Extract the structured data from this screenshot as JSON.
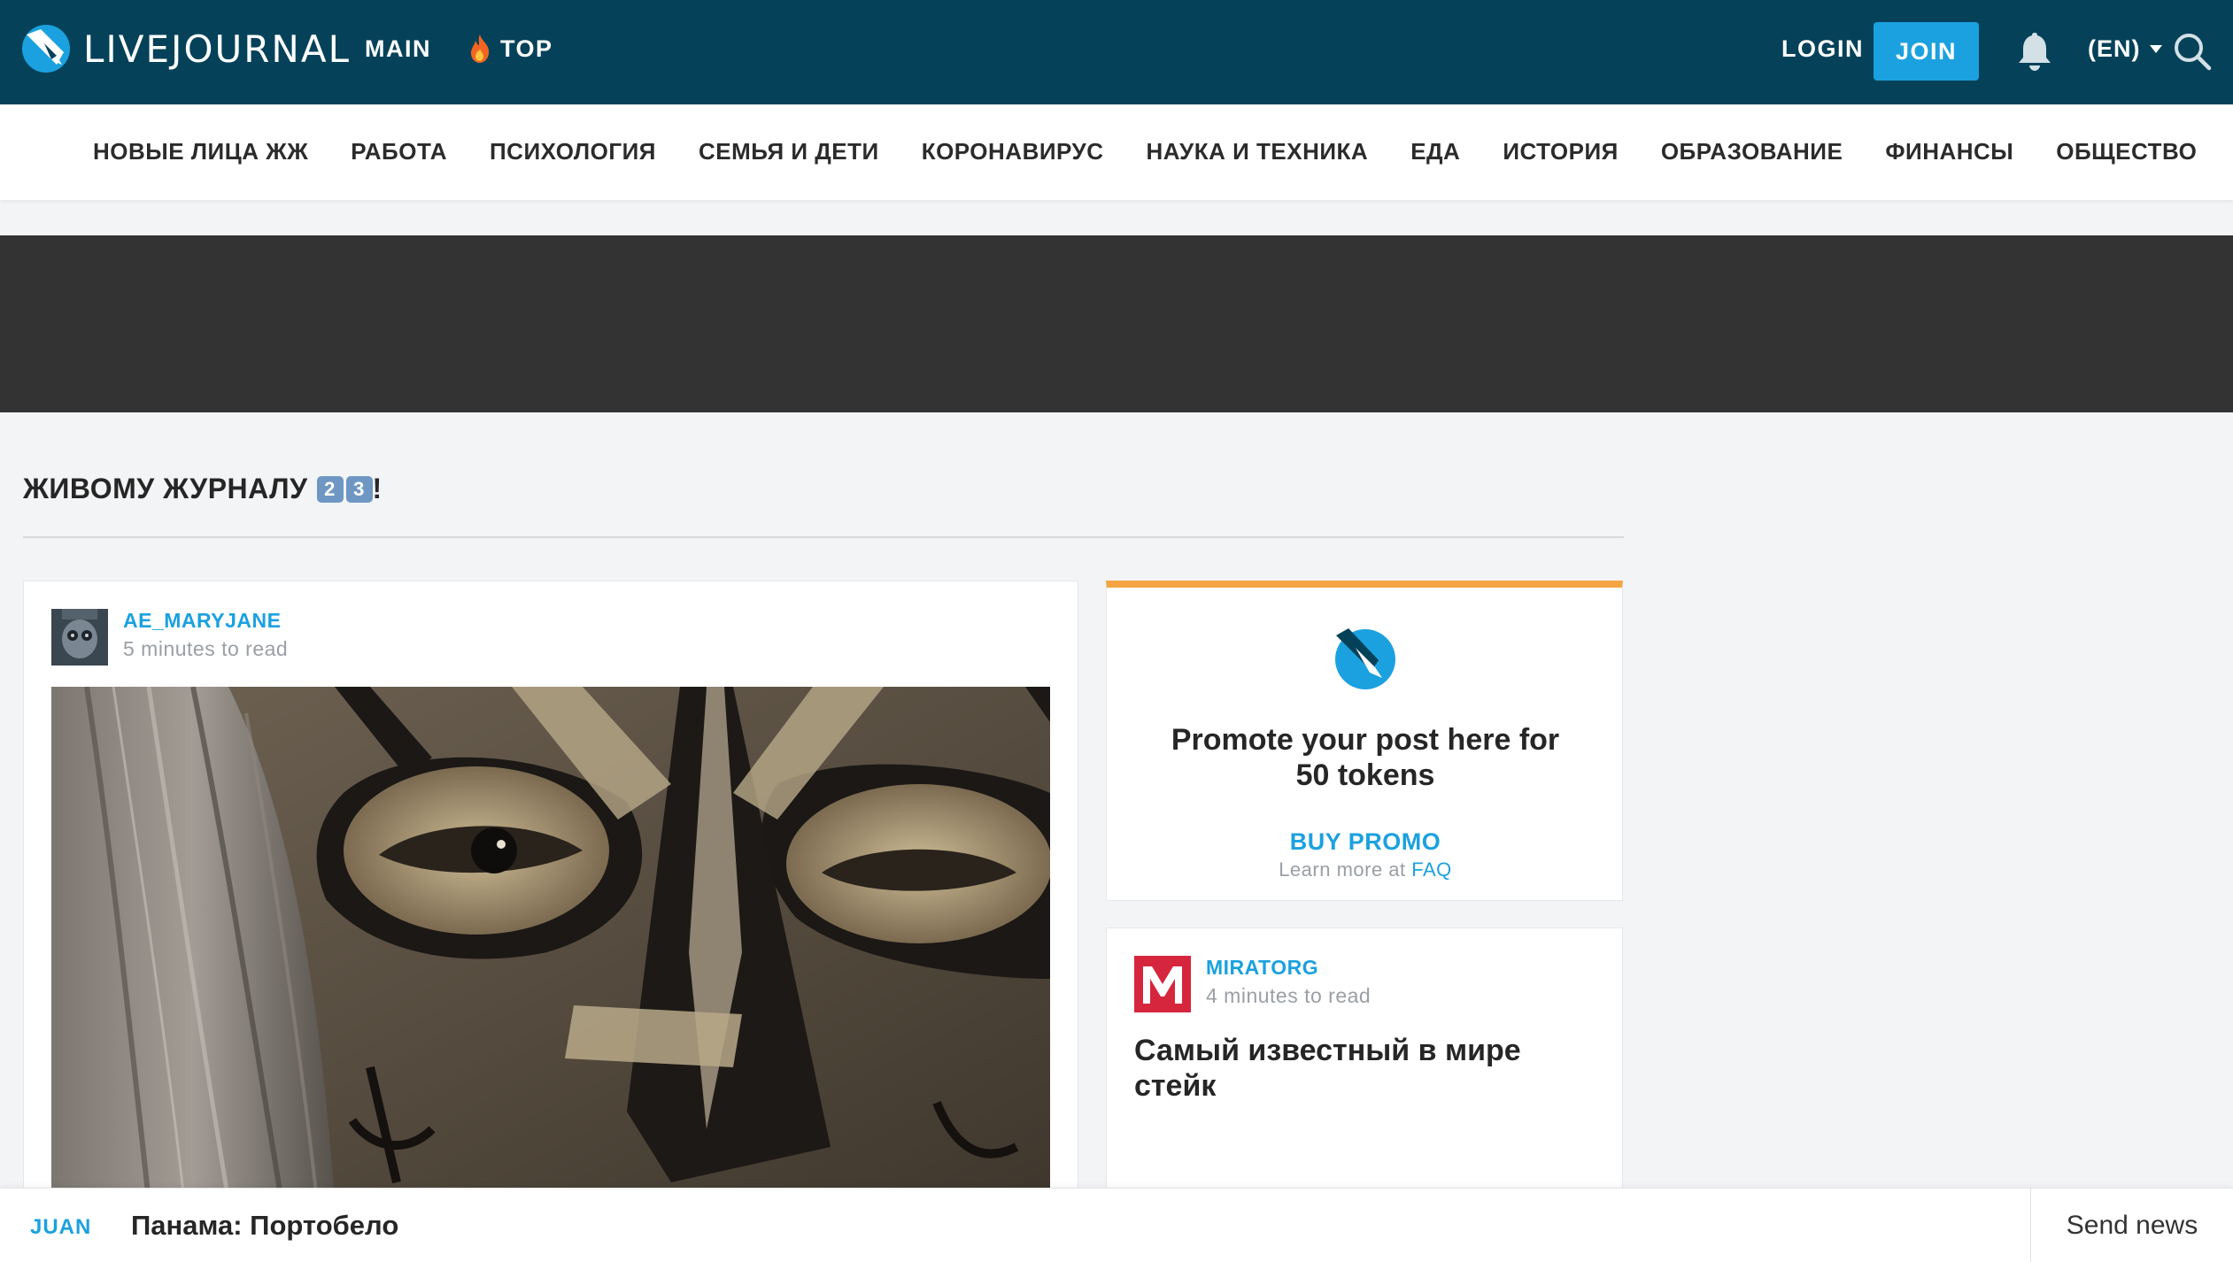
{
  "header": {
    "logo_text": "LIVEJOURNAL",
    "nav": [
      {
        "label": "MAIN"
      },
      {
        "label": "TOP",
        "icon": "flame-icon"
      }
    ],
    "login_label": "LOGIN",
    "join_label": "JOIN",
    "language_label": "(EN)",
    "colors": {
      "bar": "#054259",
      "accent": "#1ba1df"
    }
  },
  "categories": [
    "НОВЫЕ ЛИЦА ЖЖ",
    "РАБОТА",
    "ПСИХОЛОГИЯ",
    "СЕМЬЯ И ДЕТИ",
    "КОРОНАВИРУС",
    "НАУКА И ТЕХНИКА",
    "ЕДА",
    "ИСТОРИЯ",
    "ОБРАЗОВАНИЕ",
    "ФИНАНСЫ",
    "ОБЩЕСТВО"
  ],
  "section": {
    "title": "ЖИВОМУ ЖУРНАЛУ",
    "keycaps": [
      "2",
      "3"
    ],
    "suffix": "!"
  },
  "post": {
    "author": "AE_MARYJANE",
    "read_time": "5 minutes to read"
  },
  "promo": {
    "text": "Promote your post here for 50 tokens",
    "button_label": "BUY PROMO",
    "learn_more_prefix": "Learn more at",
    "faq_label": "FAQ",
    "accent_color": "#f5a442"
  },
  "feature_post": {
    "author": "MIRATORG",
    "read_time": "4 minutes to read",
    "title": "Самый известный в мире стейк",
    "logo_letter": "M",
    "logo_color": "#d6263d"
  },
  "newsbar": {
    "author": "JUAN",
    "title": "Панама: Портобело",
    "send_label": "Send news"
  }
}
